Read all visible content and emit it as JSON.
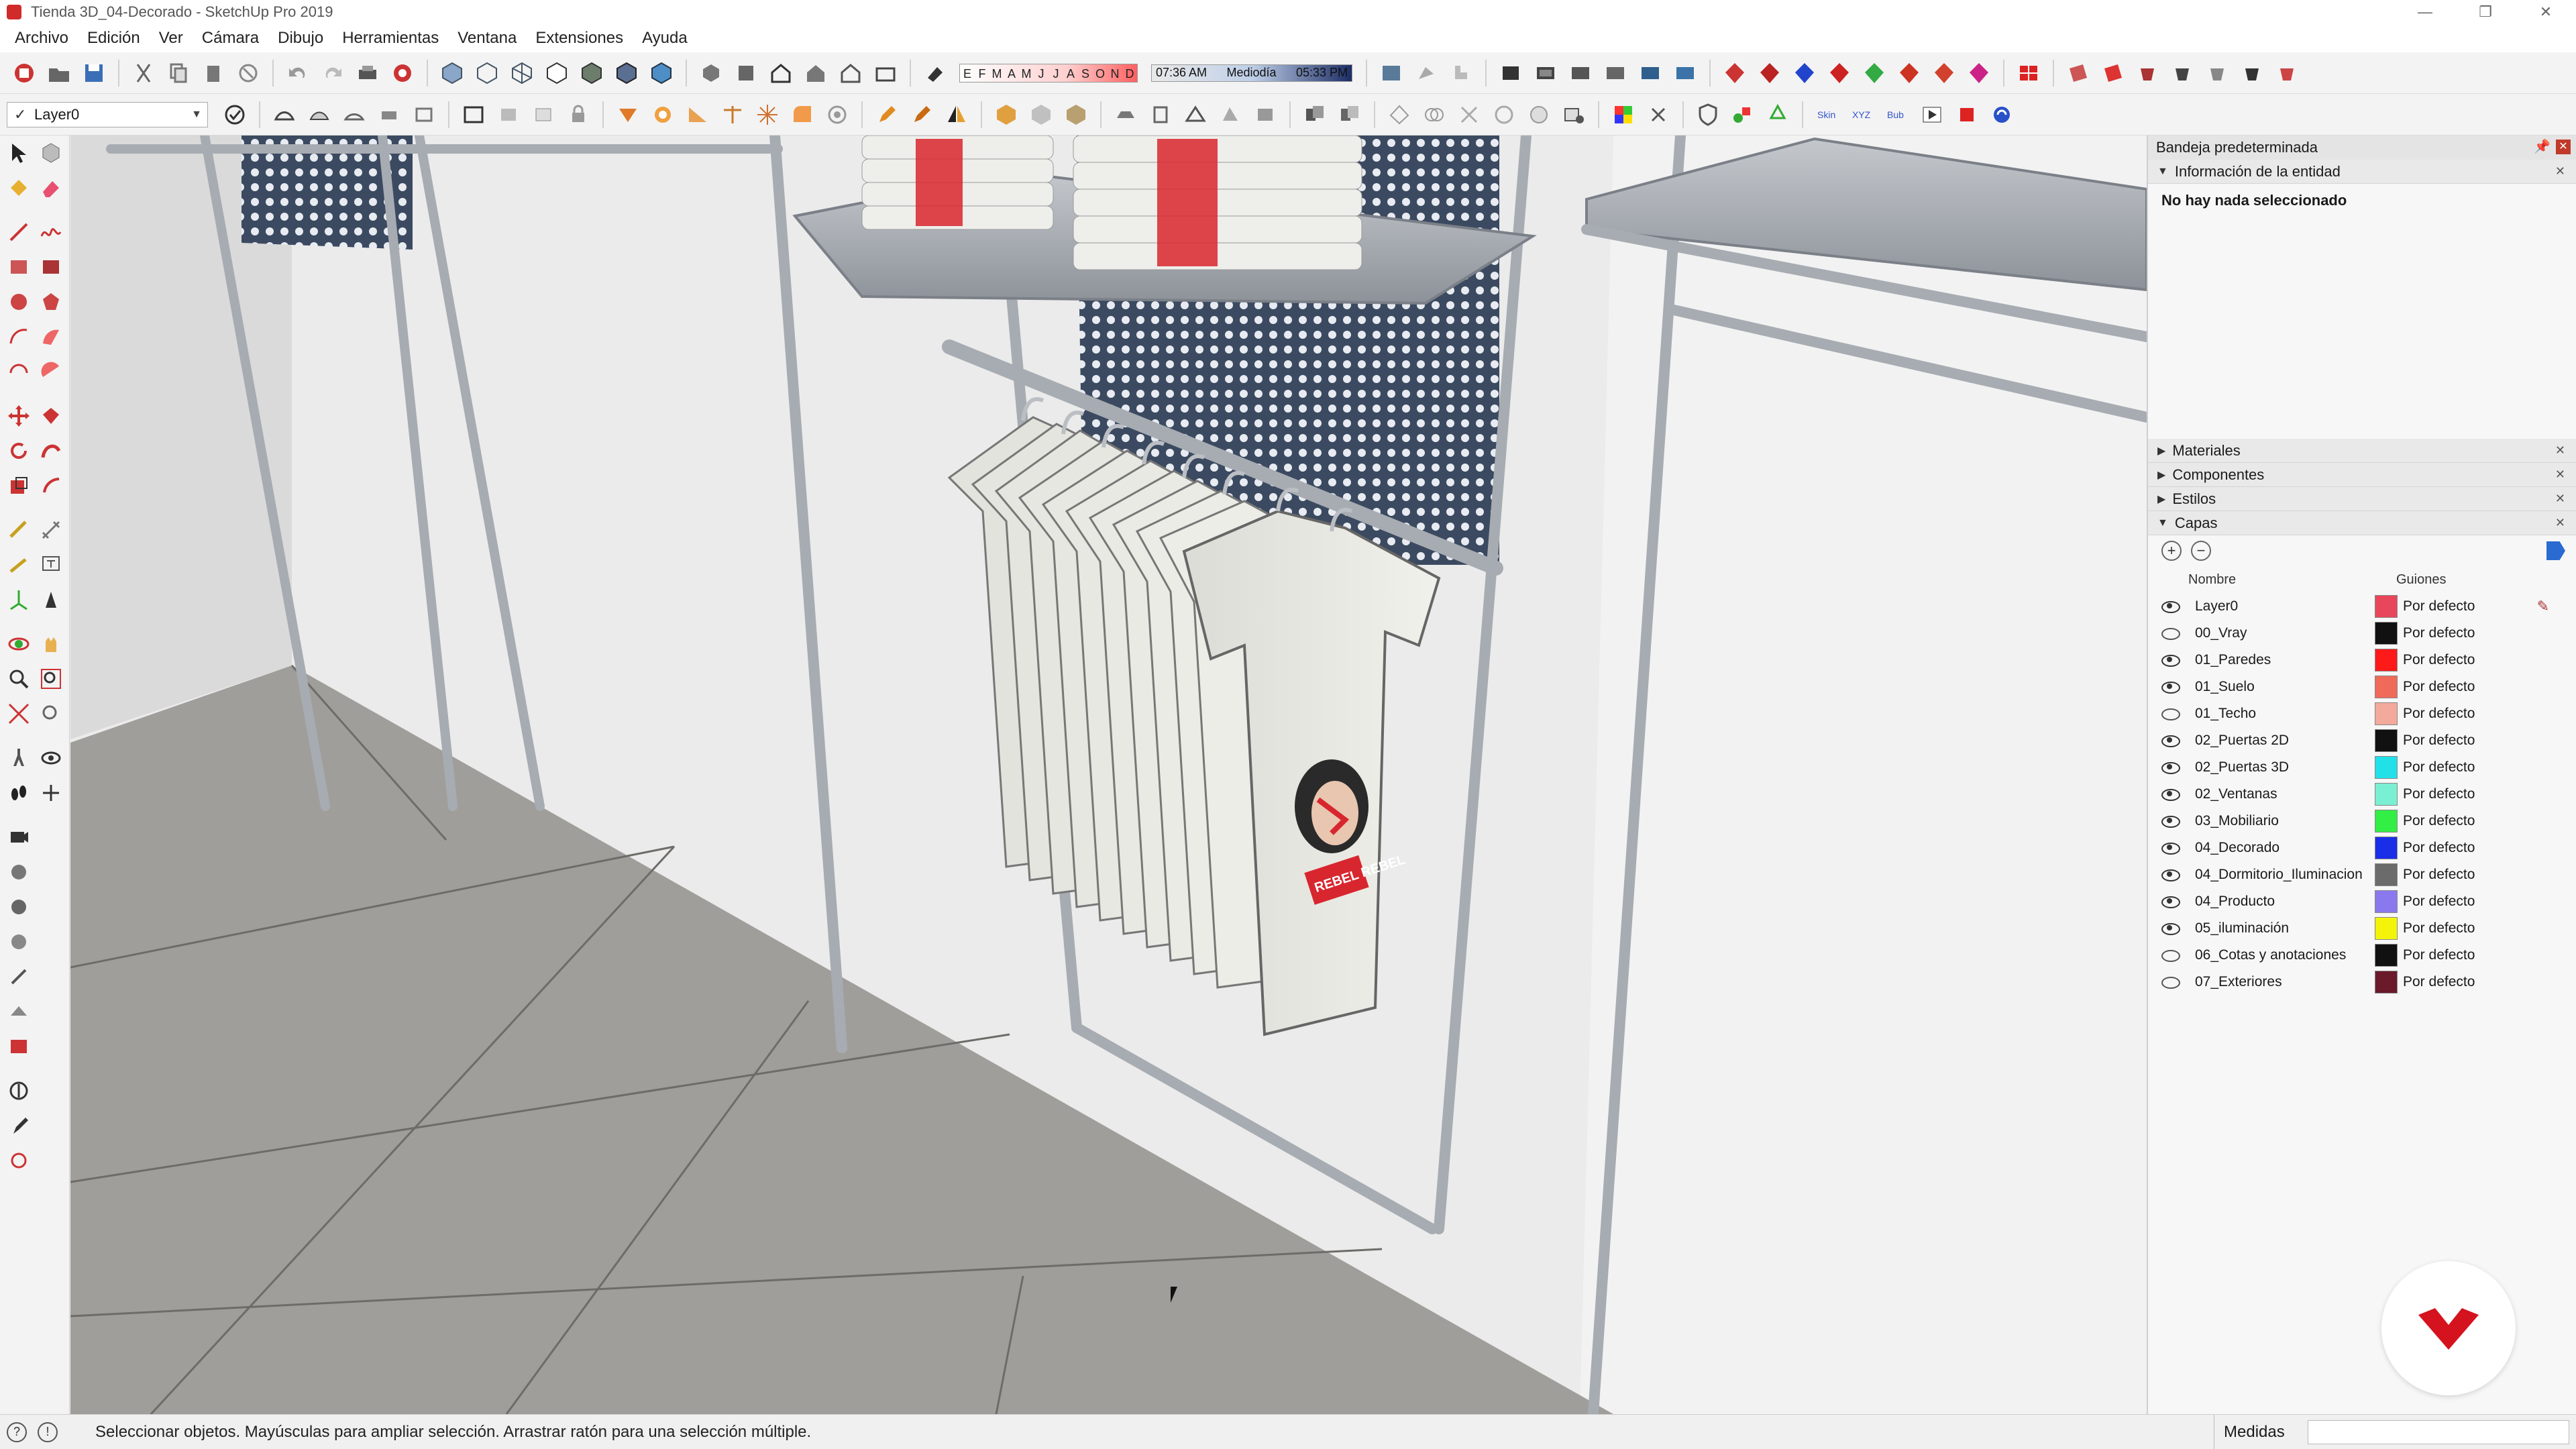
{
  "window": {
    "title": "Tienda 3D_04-Decorado - SketchUp Pro 2019"
  },
  "menubar": {
    "items": [
      "Archivo",
      "Edición",
      "Ver",
      "Cámara",
      "Dibujo",
      "Herramientas",
      "Ventana",
      "Extensiones",
      "Ayuda"
    ]
  },
  "toolbar": {
    "layer_selector": "Layer0",
    "shadow_months": [
      "E",
      "F",
      "M",
      "A",
      "M",
      "J",
      "J",
      "A",
      "S",
      "O",
      "N",
      "D"
    ],
    "time_start": "07:36 AM",
    "time_mid": "Mediodía",
    "time_end": "05:33 PM"
  },
  "tray": {
    "title": "Bandeja predeterminada",
    "entity_info": {
      "title": "Información de la entidad",
      "message": "No hay nada seleccionado"
    },
    "sections": [
      "Materiales",
      "Componentes",
      "Estilos",
      "Capas"
    ],
    "layers": {
      "col_name": "Nombre",
      "col_dashes": "Guiones",
      "rows": [
        {
          "name": "Layer0",
          "visible": true,
          "color": "#e8465a",
          "dash": "Por defecto"
        },
        {
          "name": "00_Vray",
          "visible": false,
          "color": "#111111",
          "dash": "Por defecto"
        },
        {
          "name": "01_Paredes",
          "visible": true,
          "color": "#ff1a1a",
          "dash": "Por defecto"
        },
        {
          "name": "01_Suelo",
          "visible": true,
          "color": "#f06a5a",
          "dash": "Por defecto"
        },
        {
          "name": "01_Techo",
          "visible": false,
          "color": "#f3a99b",
          "dash": "Por defecto"
        },
        {
          "name": "02_Puertas 2D",
          "visible": true,
          "color": "#111111",
          "dash": "Por defecto"
        },
        {
          "name": "02_Puertas 3D",
          "visible": true,
          "color": "#22e0e8",
          "dash": "Por defecto"
        },
        {
          "name": "02_Ventanas",
          "visible": true,
          "color": "#7af0d2",
          "dash": "Por defecto"
        },
        {
          "name": "03_Mobiliario",
          "visible": true,
          "color": "#33ee44",
          "dash": "Por defecto"
        },
        {
          "name": "04_Decorado",
          "visible": true,
          "color": "#1a2ee8",
          "dash": "Por defecto"
        },
        {
          "name": "04_Dormitorio_Iluminacion",
          "visible": true,
          "color": "#6b6b6b",
          "dash": "Por defecto"
        },
        {
          "name": "04_Producto",
          "visible": true,
          "color": "#8a79ee",
          "dash": "Por defecto"
        },
        {
          "name": "05_iluminación",
          "visible": true,
          "color": "#f4f40a",
          "dash": "Por defecto"
        },
        {
          "name": "06_Cotas y anotaciones",
          "visible": false,
          "color": "#111111",
          "dash": "Por defecto"
        },
        {
          "name": "07_Exteriores",
          "visible": false,
          "color": "#6a1a2a",
          "dash": "Por defecto"
        }
      ]
    }
  },
  "status": {
    "message": "Seleccionar objetos. Mayúsculas para ampliar selección. Arrastrar ratón para una selección múltiple.",
    "measures_label": "Medidas"
  },
  "shirt": {
    "print_text": "REBEL REBEL"
  },
  "colors": {
    "accent_red": "#d12a2a",
    "tray_header": "#e9e9e9",
    "floor": "#9c9a96",
    "wall": "#e9e9e9"
  }
}
